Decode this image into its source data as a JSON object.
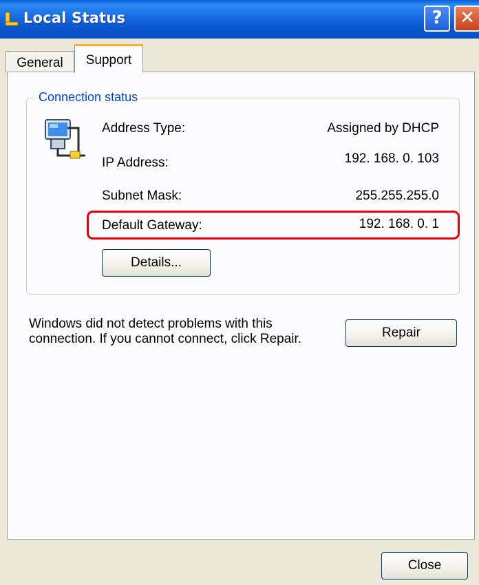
{
  "window": {
    "title": "Local Status",
    "help_glyph": "?",
    "close_glyph": "✕"
  },
  "tabs": [
    {
      "label": "General",
      "selected": false
    },
    {
      "label": "Support",
      "selected": true
    }
  ],
  "connection_status": {
    "group_title": "Connection status",
    "rows": [
      {
        "label": "Address Type:",
        "value": "Assigned by DHCP"
      },
      {
        "label": "IP Address:",
        "value": "192. 168. 0. 103"
      },
      {
        "label": "Subnet Mask:",
        "value": "255.255.255.0"
      },
      {
        "label": "Default Gateway:",
        "value": "192. 168. 0. 1"
      }
    ],
    "details_label": "Details..."
  },
  "message": "Windows did not detect problems with this connection. If you cannot connect, click Repair.",
  "repair_label": "Repair",
  "close_label": "Close",
  "colors": {
    "titlebar": "#0b57d0",
    "group_title": "#0046d5",
    "highlight": "#e8000b",
    "tab_accent": "#f7b03a"
  }
}
